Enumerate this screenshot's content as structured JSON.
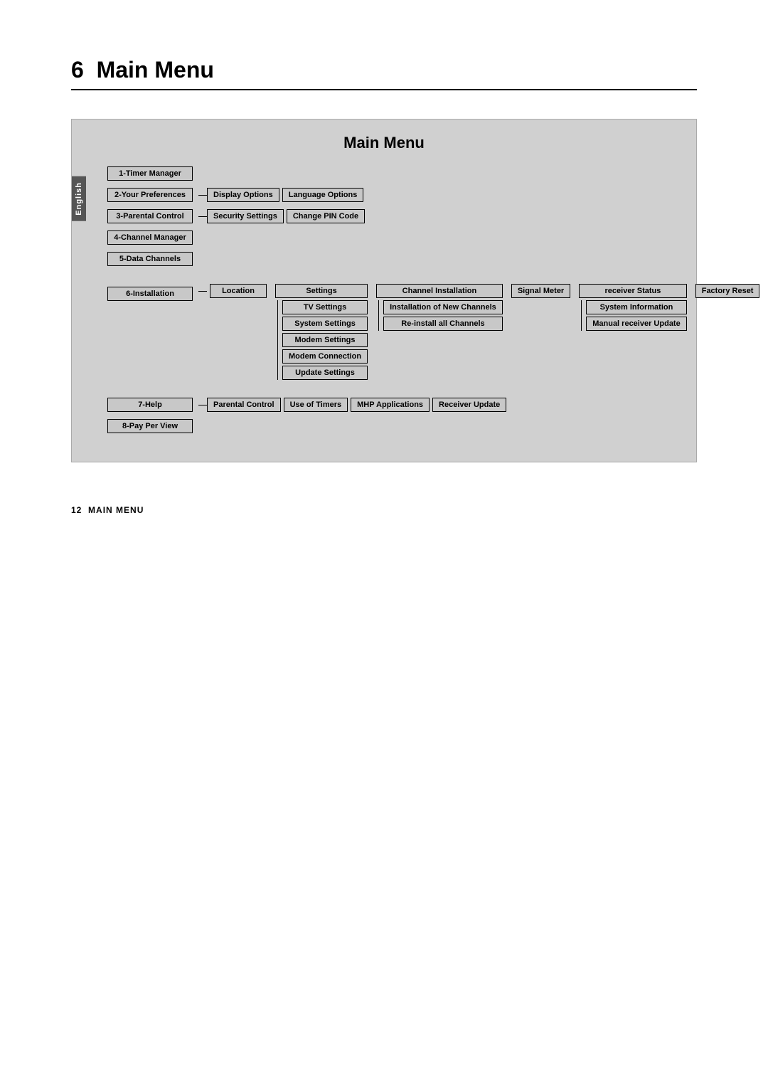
{
  "chapter": {
    "number": "6",
    "title": "Main Menu"
  },
  "diagram": {
    "title": "Main Menu",
    "side_tab": "English",
    "menu_items": [
      {
        "id": "1",
        "label": "1-Timer Manager",
        "sub_items": []
      },
      {
        "id": "2",
        "label": "2-Your Preferences",
        "sub_items": [
          "Display Options",
          "Language Options"
        ]
      },
      {
        "id": "3",
        "label": "3-Parental Control",
        "sub_items": [
          "Security Settings",
          "Change PIN Code"
        ]
      },
      {
        "id": "4",
        "label": "4-Channel Manager",
        "sub_items": []
      },
      {
        "id": "5",
        "label": "5-Data Channels",
        "sub_items": []
      }
    ],
    "installation": {
      "label": "6-Installation",
      "top_items": [
        "Location",
        "Settings",
        "Channel Installation",
        "Signal Meter",
        "receiver Status",
        "Factory Reset"
      ],
      "settings_sub": [
        "TV Settings",
        "System Settings",
        "Modem Settings",
        "Modem Connection",
        "Update Settings"
      ],
      "channel_sub": [
        "Installation of New Channels",
        "Re-install all Channels"
      ],
      "receiver_sub": [
        "System Information",
        "Manual receiver Update"
      ]
    },
    "help": {
      "label": "7-Help",
      "sub_items": [
        "Parental Control",
        "Use of Timers",
        "MHP Applications",
        "Receiver Update"
      ]
    },
    "pay_per_view": {
      "label": "8-Pay Per View"
    }
  },
  "footer": {
    "page_number": "12",
    "section_label": "MAIN MENU"
  }
}
